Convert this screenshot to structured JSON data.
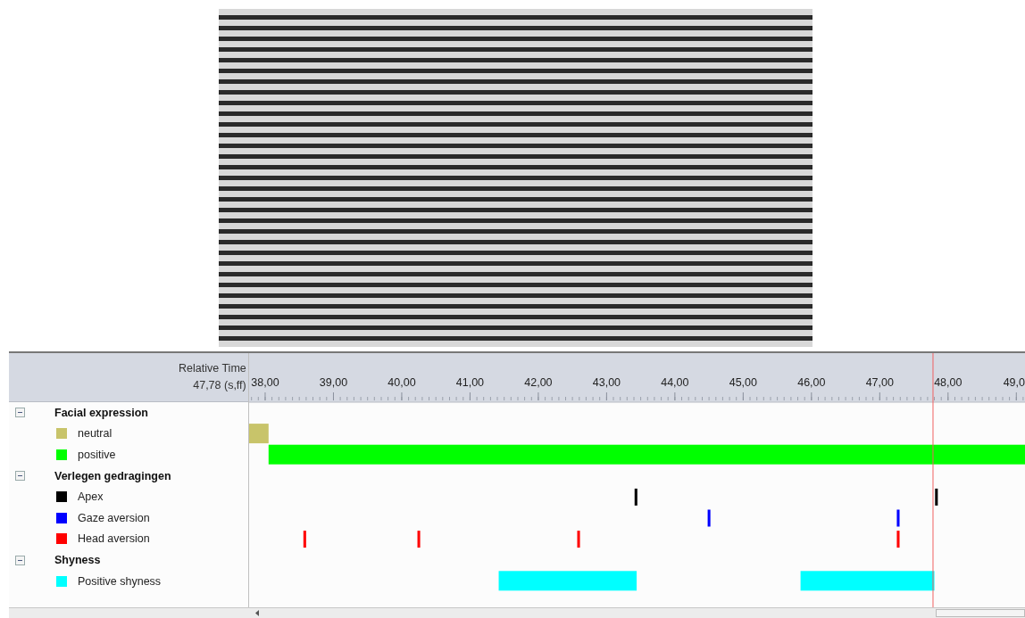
{
  "video": {
    "kind": "photo"
  },
  "timeline": {
    "time_label": "Relative Time",
    "current_time": "47,78 (s,ff)",
    "groups": [
      {
        "name": "Facial expression",
        "expanded": true,
        "behaviors": [
          {
            "name": "neutral",
            "color": "#c8c46a"
          },
          {
            "name": "positive",
            "color": "#00ff00"
          }
        ]
      },
      {
        "name": "Verlegen gedragingen",
        "expanded": true,
        "behaviors": [
          {
            "name": "Apex",
            "color": "#000000"
          },
          {
            "name": "Gaze aversion",
            "color": "#0000ff"
          },
          {
            "name": "Head aversion",
            "color": "#ff0000"
          }
        ]
      },
      {
        "name": "Shyness",
        "expanded": true,
        "behaviors": [
          {
            "name": "Positive shyness",
            "color": "#00ffff"
          }
        ]
      }
    ],
    "ruler": [
      "38,00",
      "39,00",
      "40,00",
      "41,00",
      "42,00",
      "43,00",
      "44,00",
      "45,00",
      "46,00",
      "47,00",
      "48,00",
      "49,0"
    ]
  }
}
